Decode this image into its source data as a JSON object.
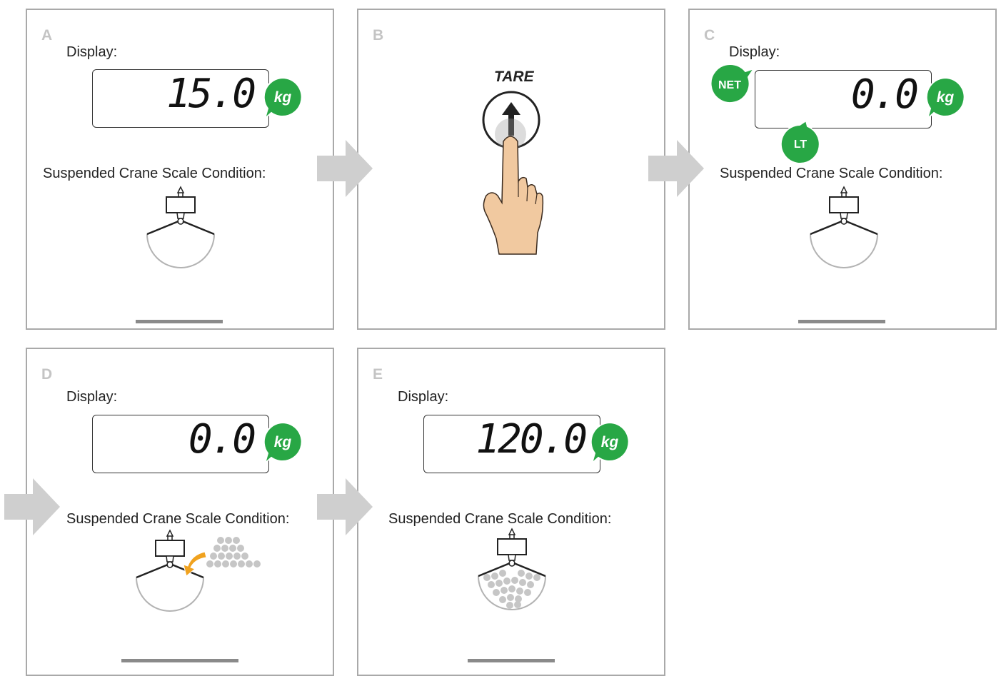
{
  "colors": {
    "badge": "#28a745",
    "arrow": "#cfcfcf",
    "border": "#a9a9a9",
    "hand": "#f1c9a0",
    "ball": "#c6c6c6",
    "curve_arrow": "#f0a21f"
  },
  "panels": {
    "a": {
      "letter": "A",
      "display_label": "Display:",
      "reading": "15.0",
      "unit": "kg",
      "condition_label": "Suspended Crane Scale Condition:"
    },
    "b": {
      "letter": "B",
      "button_label": "TARE",
      "icon": "arrow-up-icon"
    },
    "c": {
      "letter": "C",
      "display_label": "Display:",
      "reading": "0.0",
      "unit": "kg",
      "net": "NET",
      "lt": "LT",
      "condition_label": "Suspended Crane Scale Condition:"
    },
    "d": {
      "letter": "D",
      "display_label": "Display:",
      "reading": "0.0",
      "unit": "kg",
      "condition_label": "Suspended Crane Scale Condition:"
    },
    "e": {
      "letter": "E",
      "display_label": "Display:",
      "reading": "120.0",
      "unit": "kg",
      "condition_label": "Suspended Crane Scale Condition:"
    }
  }
}
